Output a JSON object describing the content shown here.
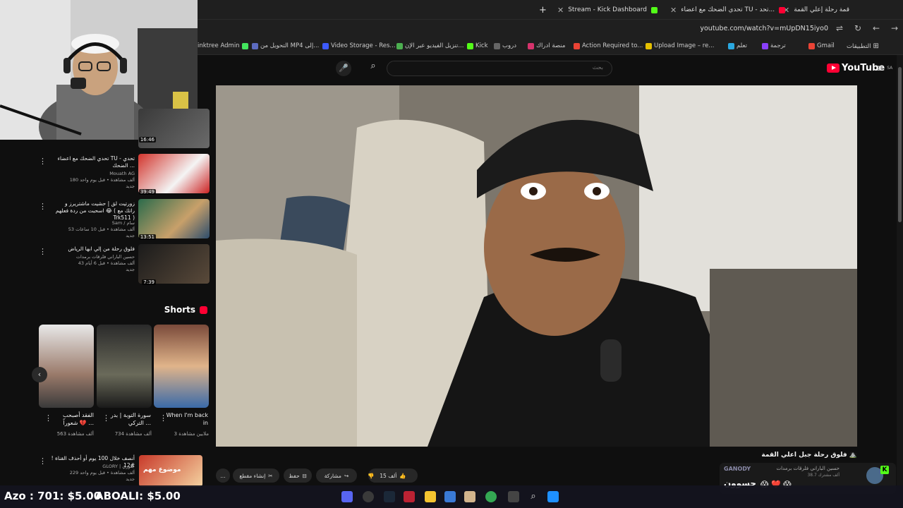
{
  "browser": {
    "tabs": [
      {
        "label": "قمة رحلة إعلي القمة",
        "active": true
      },
      {
        "label": "تحدي الضحك مع اعضاء TU - تحد...",
        "active": false
      },
      {
        "label": "Stream - Kick Dashboard",
        "active": false
      }
    ],
    "new_tab": "+",
    "url": "youtube.com/watch?v=mUpDN15iyo0",
    "bookmarks": [
      "التطبيقات",
      "Gmail",
      "ترجمة",
      "تعلم",
      "Upload Image – re...",
      "Action Required to...",
      "منصة ادراك",
      "دروب",
      "Kick",
      "تنزيل الفيديو عبر الإن...",
      "Video Storage - Res...",
      "التحويل من MP4 إلى...",
      "inktree Admin"
    ]
  },
  "youtube": {
    "search_placeholder": "بحث",
    "logo_text": "YouTube",
    "logo_region": "SA",
    "colors": {
      "brand_red": "#ff0033",
      "kick_green": "#53fc18",
      "bg": "#0f0f0f"
    }
  },
  "recommendations": [
    {
      "title": "",
      "channel": "",
      "meta": "",
      "duration": "16:46"
    },
    {
      "title": "تحدي الضحك مع اعضاء TU - تحدي الضحك ...",
      "channel": "Mouath AG",
      "meta": "180 ألف مشاهدة • قبل يوم واحد",
      "badge": "جديد",
      "duration": "39:49"
    },
    {
      "title": "زورتيت لق | حشيت ماشتريرز و اسحبت من ردة فعلهم 😂 ( راتك مع Trk511 )",
      "channel": "Sam / سام",
      "meta": "53 ألف مشاهدة • قبل 10 ساعات",
      "badge": "جديد",
      "duration": "13:51"
    },
    {
      "title": "فلوق رحلة من إلي ابها الرياض",
      "channel": "حسين الباراني فلرقات برمدات",
      "meta": "43 ألف مشاهدة • قبل 6 أيام",
      "badge": "جديد",
      "duration": "7:39"
    }
  ],
  "shorts": {
    "title": "Shorts",
    "items": [
      {
        "title": "When I'm back in",
        "views": "3 ملايين مشاهدة"
      },
      {
        "title": "سورة التوبة | بدر التركي ...",
        "views": "734 ألف مشاهدة"
      },
      {
        "title": "الفقد أصبحب شعوراً 💔 ...",
        "views": "563 ألف مشاهدة"
      }
    ]
  },
  "bottom_rec": {
    "title": "أنصف خلال 100 يوم أو أحذف القناة ! #12",
    "channel": "GLORY | جلوري",
    "meta": "229 ألف مشاهدة • قبل يوم واحد",
    "badge": "جديد",
    "thumb_text": "موضوع مهم"
  },
  "video": {
    "title": "فلوق رحلة جبل اعلي القمة ⛰️",
    "actions": {
      "likes": "15 ألف",
      "share": "مشاركة",
      "save": "حفظ",
      "clip": "إنشاء مقطع",
      "more": "..."
    }
  },
  "stream_overlay": {
    "donation_1": "Azo : 701: $5.00",
    "donation_2": "ABOALI: $5.00",
    "notif_name": "GANODY",
    "notif_channel": "حسين الباراني فلرقات برمدات",
    "notif_meta": "38.7 ألف مشترك",
    "chat_name": "حسوون",
    "chat_emotes": "😱 ❤️ 😱"
  },
  "webcam": {
    "label": "webcam"
  }
}
